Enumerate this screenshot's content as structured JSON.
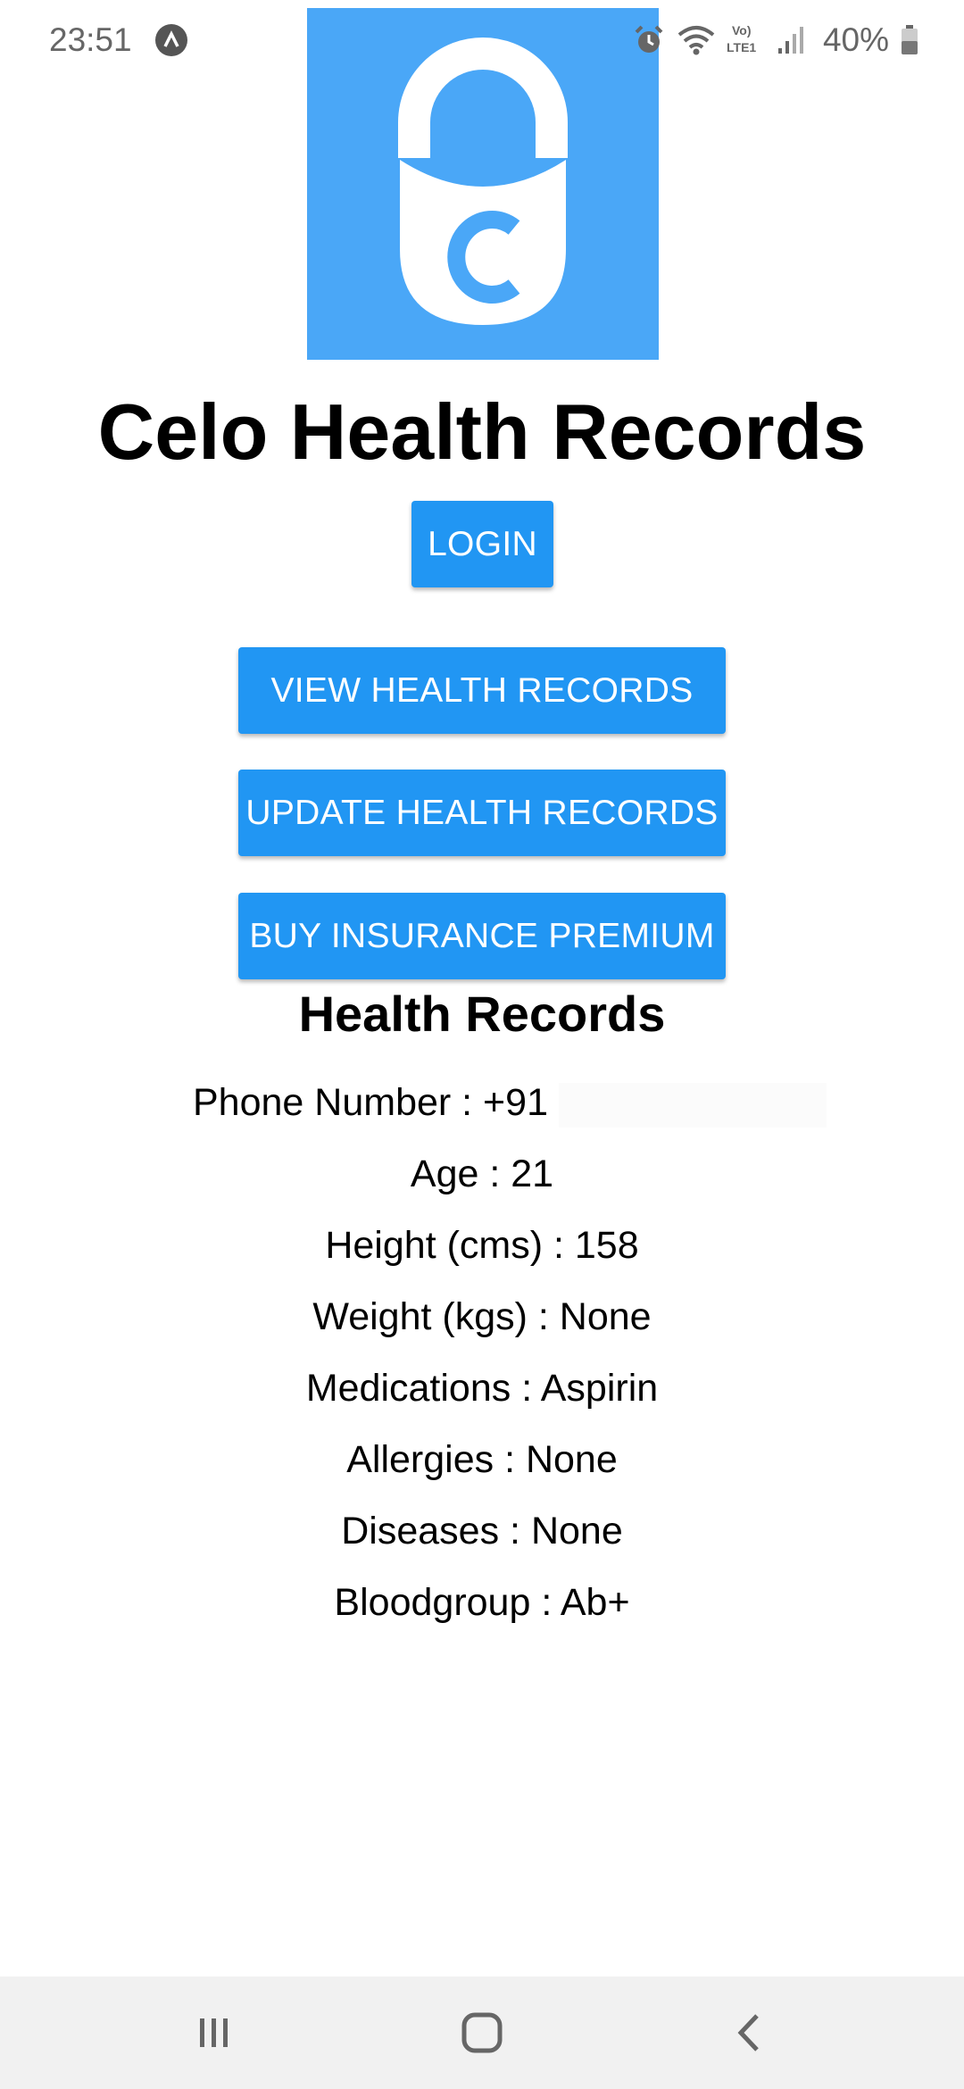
{
  "status_bar": {
    "time": "23:51",
    "battery_percent": "40%",
    "network_label": "VoLTE1",
    "icons": [
      "app-notification-icon",
      "alarm-icon",
      "wifi-icon",
      "volte-icon",
      "signal-icon",
      "battery-icon"
    ]
  },
  "app": {
    "title": "Celo Health Records",
    "logo": "padlock-c-logo",
    "brand_color": "#4aa7f7",
    "button_color": "#2196f3"
  },
  "buttons": {
    "login": "LOGIN",
    "view": "VIEW HEALTH RECORDS",
    "update": "UPDATE HEALTH RECORDS",
    "buy": "BUY INSURANCE PREMIUM"
  },
  "records": {
    "heading": "Health Records",
    "phone": "Phone Number : +91",
    "age": "Age : 21",
    "height": "Height (cms) : 158",
    "weight": "Weight (kgs) : None",
    "medications": "Medications : Aspirin",
    "allergies": "Allergies : None",
    "diseases": "Diseases : None",
    "bloodgroup": "Bloodgroup : Ab+"
  },
  "nav_bar": {
    "icons": [
      "recent-apps-icon",
      "home-icon",
      "back-icon"
    ]
  }
}
